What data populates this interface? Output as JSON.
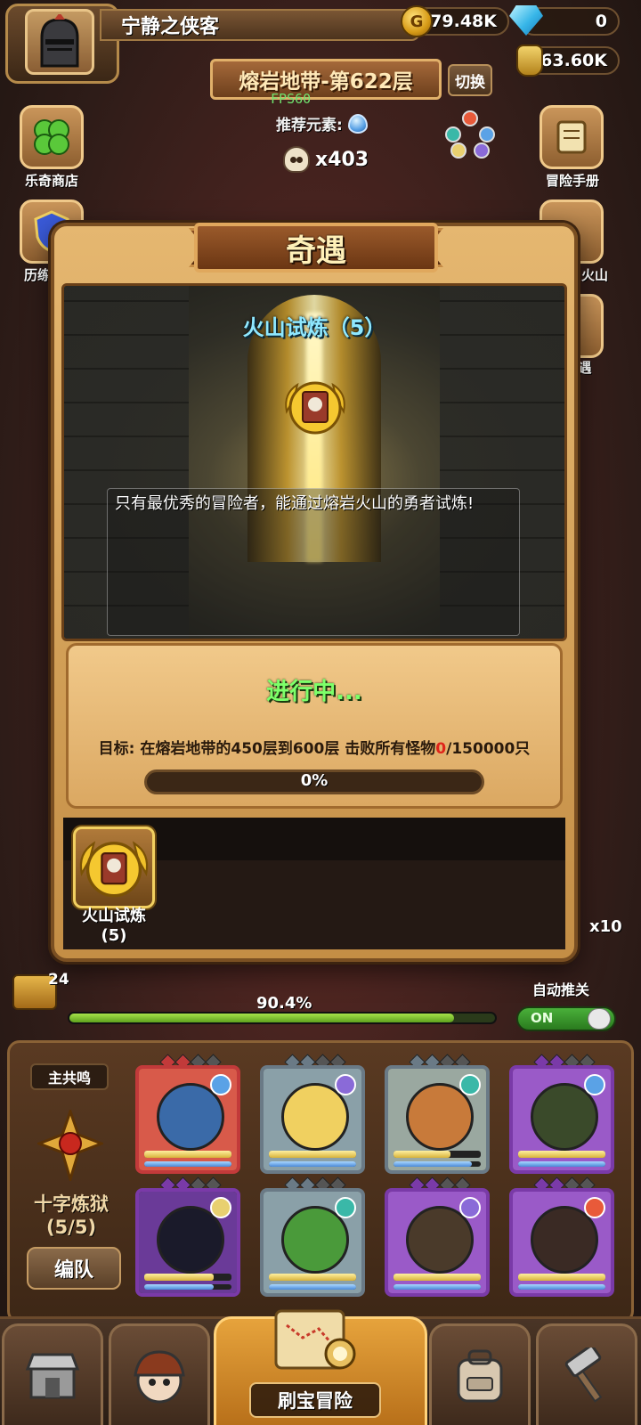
{
  "player": {
    "name": "宁静之侠客"
  },
  "resources": {
    "gold": "179.48K",
    "gems": "0",
    "potion": "63.60K"
  },
  "stage": {
    "title": "熔岩地带-第622层",
    "switch_label": "切换",
    "fps": "FPS60",
    "recommend_label": "推荐元素:",
    "kills": "x403"
  },
  "side_left": [
    {
      "label": "乐奇商店"
    },
    {
      "label": "历练"
    }
  ],
  "side_right": [
    {
      "label": "冒险手册"
    },
    {
      "label": "火山"
    },
    {
      "label": "遇"
    }
  ],
  "modal": {
    "title": "奇遇",
    "trial_name": "火山试炼（5）",
    "description": "只有最优秀的冒险者，能通过熔岩火山的勇者试炼!",
    "status": "进行中...",
    "goal_prefix": "目标: 在熔岩地带的450层到600层 击败所有怪物",
    "goal_current": "0",
    "goal_total": "/150000只",
    "progress_text": "0%",
    "progress_value": 0,
    "reward": {
      "label_line1": "火山试炼",
      "label_line2": "(5)"
    }
  },
  "side_counter": "x10",
  "hud": {
    "chest_count": "24",
    "track_percent": "90.4%",
    "track_value": 0.904,
    "auto_label": "自动推关",
    "auto_state": "ON"
  },
  "team": {
    "leader_tag": "主共鸣",
    "formation_name": "十字炼狱",
    "formation_count": "(5/5)",
    "edit_label": "编队",
    "heroes": [
      {
        "frame": "#c23a3a",
        "bg": "#d85a4a",
        "face": "#3a6aa8",
        "elem": "#5aa2e6",
        "hp": 1.0,
        "mp": 1.0
      },
      {
        "frame": "#6a7a86",
        "bg": "#8aa0a8",
        "face": "#f0d060",
        "elem": "#8a6ad8",
        "hp": 1.0,
        "mp": 1.0
      },
      {
        "frame": "#6a7a86",
        "bg": "#9aa8a0",
        "face": "#c87a3a",
        "elem": "#3ab8a8",
        "hp": 0.65,
        "mp": 0.9
      },
      {
        "frame": "#7a3aa8",
        "bg": "#9a5ac8",
        "face": "#3a4a2a",
        "elem": "#5aa2e6",
        "hp": 1.0,
        "mp": 1.0
      },
      {
        "frame": "#7a3aa8",
        "bg": "#6a3a98",
        "face": "#1a1a2a",
        "elem": "#e8d070",
        "hp": 0.8,
        "mp": 0.8
      },
      {
        "frame": "#6a7a86",
        "bg": "#8aa0a8",
        "face": "#4a9a3a",
        "elem": "#3ab8a8",
        "hp": 1.0,
        "mp": 1.0
      },
      {
        "frame": "#7a3aa8",
        "bg": "#9a5ac8",
        "face": "#4a3a2a",
        "elem": "#8a6ad8",
        "hp": 1.0,
        "mp": 1.0
      },
      {
        "frame": "#7a3aa8",
        "bg": "#9a5ac8",
        "face": "#3a2a24",
        "elem": "#e85a3a",
        "hp": 1.0,
        "mp": 1.0
      }
    ]
  },
  "nav": {
    "active_label": "刷宝冒险"
  }
}
